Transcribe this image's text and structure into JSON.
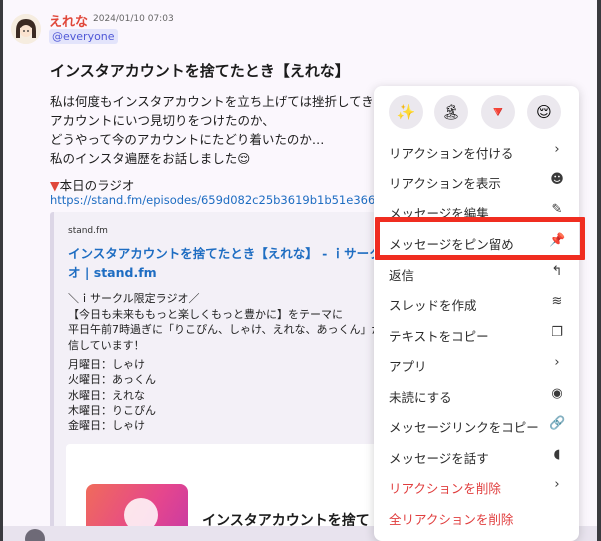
{
  "message": {
    "author": "えれな",
    "timestamp": "2024/01/10 07:03",
    "mention": "@everyone",
    "title": "インスタアカウントを捨てたとき【えれな】",
    "body_lines": [
      "私は何度もインスタアカウントを立ち上げては挫折してき",
      "アカウントにいつ見切りをつけたのか、",
      "どうやって今のアカウントにたどり着いたのか…",
      "私のインスタ遍歴をお話しました😌"
    ],
    "radio_label": "本日のラジオ",
    "radio_marker": "▼",
    "link": "https://stand.fm/episodes/659d082c25b3619b1b51e366"
  },
  "embed": {
    "site": "stand.fm",
    "title": "インスタアカウントを捨てたとき【えれな】 - ｉサーク",
    "title_line2": "オ | stand.fm",
    "desc_lines": [
      "＼ｉサークル限定ラジオ／",
      "【今日も未来ももっと楽しくもっと豊かに】をテーマに",
      "平日午前7時過ぎに「りこぴん、しゃけ、えれな、あっくん」が",
      "信しています！"
    ],
    "days": [
      "月曜日：しゃけ",
      "火曜日：あっくん",
      "水曜日：えれな",
      "木曜日：りこぴん",
      "金曜日：しゃけ"
    ],
    "card_title": "インスタアカウントを捨て"
  },
  "menu": {
    "reactions": [
      "✨",
      "🏝",
      "🔻",
      "😌"
    ],
    "items": [
      {
        "label": "リアクションを付ける",
        "icon": "›",
        "danger": false
      },
      {
        "label": "リアクションを表示",
        "icon": "☻",
        "danger": false
      },
      {
        "label": "メッセージを編集",
        "icon": "✎",
        "danger": false
      },
      {
        "label": "メッセージをピン留め",
        "icon": "📌",
        "danger": false
      },
      {
        "label": "返信",
        "icon": "↰",
        "danger": false
      },
      {
        "label": "スレッドを作成",
        "icon": "≋",
        "danger": false
      },
      {
        "label": "テキストをコピー",
        "icon": "❐",
        "danger": false
      },
      {
        "label": "アプリ",
        "icon": "›",
        "danger": false
      },
      {
        "label": "未読にする",
        "icon": "◉",
        "danger": false
      },
      {
        "label": "メッセージリンクをコピー",
        "icon": "🔗",
        "danger": false
      },
      {
        "label": "メッセージを話す",
        "icon": "◖",
        "danger": false
      },
      {
        "label": "リアクションを削除",
        "icon": "›",
        "danger": true
      },
      {
        "label": "全リアクションを削除",
        "icon": "",
        "danger": true
      }
    ]
  },
  "colors": {
    "highlight": "#f02d20",
    "danger": "#e03d3d",
    "link": "#1e6dc2",
    "author": "#e0473a"
  }
}
